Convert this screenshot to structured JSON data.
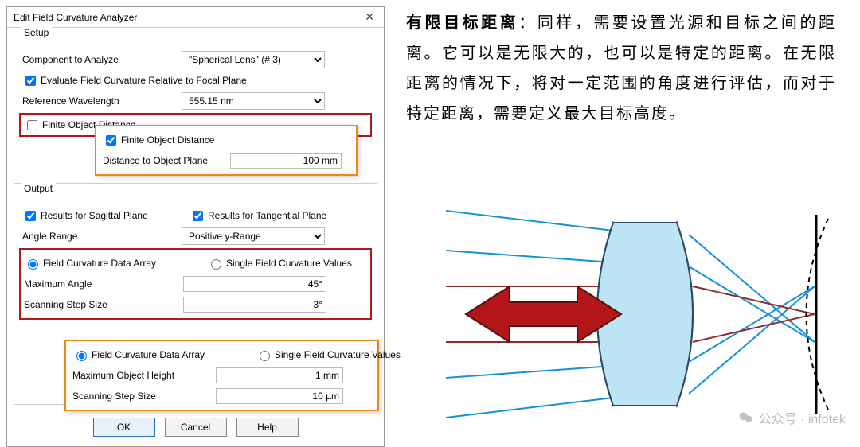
{
  "dialog": {
    "title": "Edit Field Curvature Analyzer",
    "setup": {
      "title": "Setup",
      "component_label": "Component to Analyze",
      "component_value": "\"Spherical Lens\" (# 3)",
      "evaluate_relative_label": "Evaluate Field Curvature Relative to Focal Plane",
      "evaluate_relative_checked": true,
      "ref_wavelength_label": "Reference Wavelength",
      "ref_wavelength_value": "555.15 nm",
      "finite_object_label": "Finite Object Distance",
      "finite_object_checked": false
    },
    "finite_callout": {
      "checkbox_label": "Finite Object Distance",
      "checkbox_checked": true,
      "distance_label": "Distance to Object Plane",
      "distance_value": "100 mm"
    },
    "output": {
      "title": "Output",
      "results_sagittal_label": "Results for Sagittal Plane",
      "results_sagittal_checked": true,
      "results_tangential_label": "Results for Tangential Plane",
      "results_tangential_checked": true,
      "angle_range_label": "Angle Range",
      "angle_range_value": "Positive y-Range",
      "radio_array_label": "Field Curvature Data Array",
      "radio_single_label": "Single Field Curvature Values",
      "radio_selected": "array",
      "max_angle_label": "Maximum Angle",
      "max_angle_value": "45°",
      "scan_step_label": "Scanning Step Size",
      "scan_step_value": "3°"
    },
    "object_callout": {
      "radio_array_label": "Field Curvature Data Array",
      "radio_single_label": "Single Field Curvature Values",
      "radio_selected": "array",
      "max_height_label": "Maximum Object Height",
      "max_height_value": "1 mm",
      "scan_step_label": "Scanning Step Size",
      "scan_step_value": "10 µm"
    },
    "buttons": {
      "ok": "OK",
      "cancel": "Cancel",
      "help": "Help"
    }
  },
  "article": {
    "heading": "有限目标距离",
    "body": "：同样，需要设置光源和目标之间的距离。它可以是无限大的，也可以是特定的距离。在无限距离的情况下，将对一定范围的角度进行评估，而对于特定距离，需要定义最大目标高度。"
  },
  "watermark": {
    "label": "公众号 · infotek"
  }
}
